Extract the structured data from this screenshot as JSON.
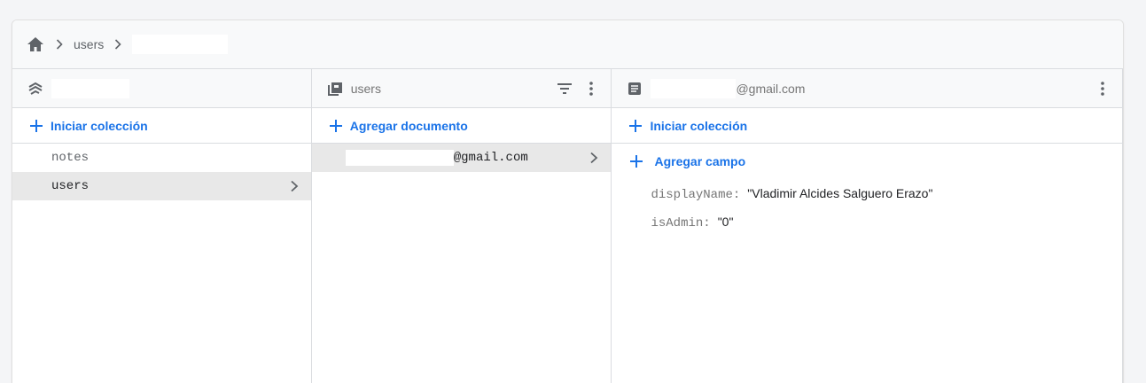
{
  "breadcrumb": {
    "home_icon": "home-icon",
    "items": [
      "users",
      ""
    ]
  },
  "colors": {
    "accent": "#1a73e8",
    "selected_bg": "#e8e8e8"
  },
  "root_column": {
    "title": "",
    "icon": "firestore-icon",
    "add_collection_label": "Iniciar colección",
    "collections": [
      "notes",
      "users"
    ],
    "selected": "users"
  },
  "collection_column": {
    "title": "users",
    "icon": "collection-icon",
    "add_document_label": "Agregar documento",
    "documents": [
      {
        "id_suffix": "@gmail.com"
      }
    ]
  },
  "document_column": {
    "title_suffix": "@gmail.com",
    "icon": "document-icon",
    "add_collection_label": "Iniciar colección",
    "add_field_label": "Agregar campo",
    "fields": [
      {
        "key": "displayName:",
        "value": "\"Vladimir Alcides Salguero Erazo\""
      },
      {
        "key": "isAdmin:",
        "value": "\"0\""
      }
    ]
  }
}
